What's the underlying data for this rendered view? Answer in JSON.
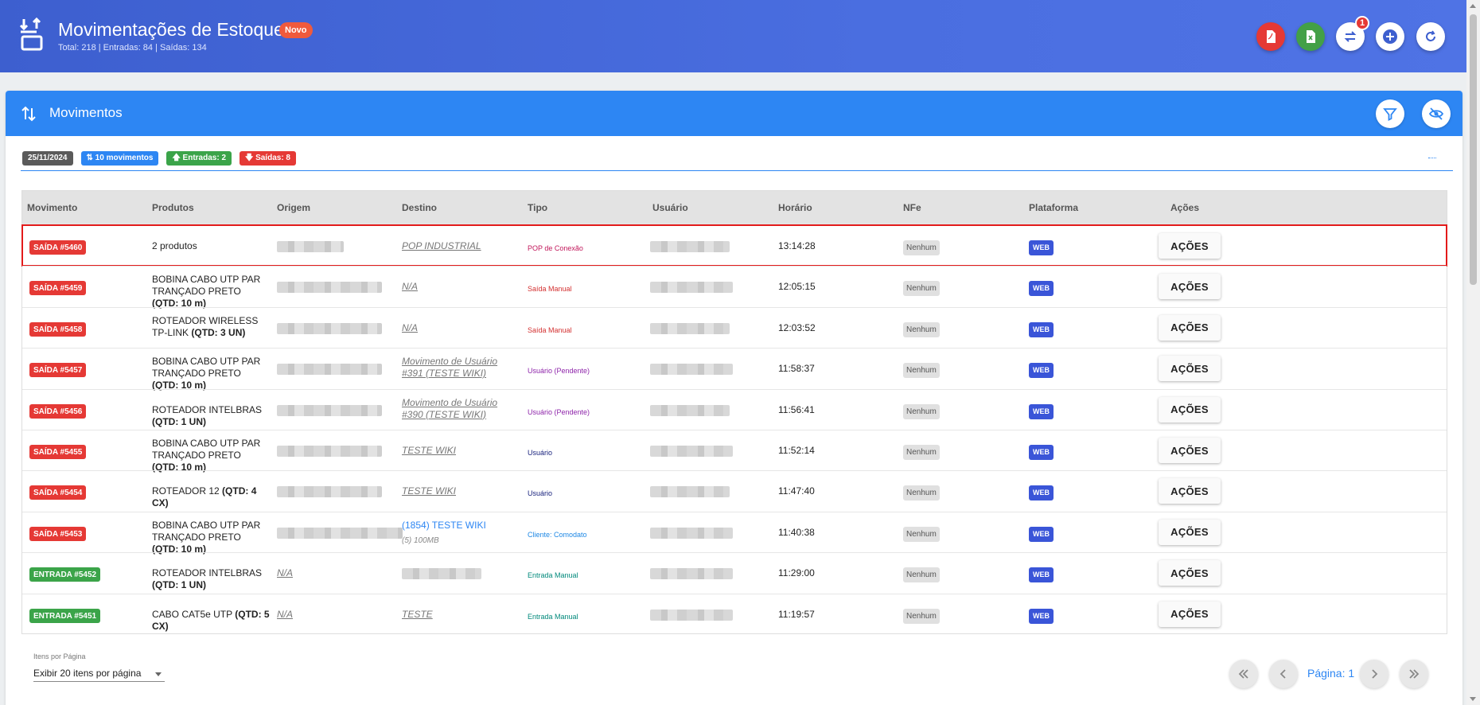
{
  "header": {
    "title": "Movimentações de Estoque",
    "new_badge": "Novo",
    "subtitle": "Total: 218 | Entradas: 84 | Saídas: 134",
    "notification_count": "1",
    "buttons": [
      "export-pdf",
      "export-excel",
      "transfers",
      "add",
      "refresh"
    ]
  },
  "panel": {
    "title": "Movimentos",
    "chips": {
      "date": "25/11/2024",
      "movements": "10 movimentos",
      "entries": "Entradas: 2",
      "exits": "Saídas: 8"
    }
  },
  "table": {
    "columns": [
      "Movimento",
      "Produtos",
      "Origem",
      "Destino",
      "Tipo",
      "Usuário",
      "Horário",
      "NFe",
      "Plataforma",
      "Ações"
    ],
    "rows": [
      {
        "movement": "SAÍDA #5460",
        "kind": "out",
        "product": "2 produtos",
        "product_qty": "",
        "origin": "",
        "dest": "POP INDUSTRIAL",
        "dest_sub": "",
        "type": "POP de Conexão",
        "type_color": "#c2185b",
        "time": "13:14:28",
        "nfe": "Nenhum",
        "platform": "WEB",
        "action": "AÇÕES"
      },
      {
        "movement": "SAÍDA #5459",
        "kind": "out",
        "product": "BOBINA CABO UTP PAR TRANÇADO PRETO",
        "product_qty": "(QTD: 10 m)",
        "origin": "",
        "dest": "N/A",
        "dest_sub": "",
        "type": "Saída Manual",
        "type_color": "#d32f2f",
        "time": "12:05:15",
        "nfe": "Nenhum",
        "platform": "WEB",
        "action": "AÇÕES"
      },
      {
        "movement": "SAÍDA #5458",
        "kind": "out",
        "product": "ROTEADOR WIRELESS TP-LINK",
        "product_qty": "(QTD: 3 UN)",
        "origin": "",
        "dest": "N/A",
        "dest_sub": "",
        "type": "Saída Manual",
        "type_color": "#d32f2f",
        "time": "12:03:52",
        "nfe": "Nenhum",
        "platform": "WEB",
        "action": "AÇÕES"
      },
      {
        "movement": "SAÍDA #5457",
        "kind": "out",
        "product": "BOBINA CABO UTP PAR TRANÇADO PRETO",
        "product_qty": "(QTD: 10 m)",
        "origin": "",
        "dest": "Movimento de Usuário #391 (TESTE WIKI)",
        "dest_sub": "",
        "type": "Usuário (Pendente)",
        "type_color": "#8e24aa",
        "time": "11:58:37",
        "nfe": "Nenhum",
        "platform": "WEB",
        "action": "AÇÕES"
      },
      {
        "movement": "SAÍDA #5456",
        "kind": "out",
        "product": "ROTEADOR INTELBRAS",
        "product_qty": "(QTD: 1 UN)",
        "origin": "",
        "dest": "Movimento de Usuário #390 (TESTE WIKI)",
        "dest_sub": "",
        "type": "Usuário (Pendente)",
        "type_color": "#8e24aa",
        "time": "11:56:41",
        "nfe": "Nenhum",
        "platform": "WEB",
        "action": "AÇÕES"
      },
      {
        "movement": "SAÍDA #5455",
        "kind": "out",
        "product": "BOBINA CABO UTP PAR TRANÇADO PRETO",
        "product_qty": "(QTD: 10 m)",
        "origin": "",
        "dest": "TESTE WIKI",
        "dest_sub": "",
        "type": "Usuário",
        "type_color": "#1a237e",
        "time": "11:52:14",
        "nfe": "Nenhum",
        "platform": "WEB",
        "action": "AÇÕES"
      },
      {
        "movement": "SAÍDA #5454",
        "kind": "out",
        "product": "ROTEADOR 12",
        "product_qty": "(QTD: 4 CX)",
        "origin": "",
        "dest": "TESTE WIKI",
        "dest_sub": "",
        "type": "Usuário",
        "type_color": "#1a237e",
        "time": "11:47:40",
        "nfe": "Nenhum",
        "platform": "WEB",
        "action": "AÇÕES"
      },
      {
        "movement": "SAÍDA #5453",
        "kind": "out",
        "product": "BOBINA CABO UTP PAR TRANÇADO PRETO",
        "product_qty": "(QTD: 10 m)",
        "origin": "",
        "dest": "(1854) TESTE WIKI",
        "dest_sub": "(5) 100MB",
        "type": "Cliente: Comodato",
        "type_color": "#1e88e5",
        "time": "11:40:38",
        "nfe": "Nenhum",
        "platform": "WEB",
        "action": "AÇÕES"
      },
      {
        "movement": "ENTRADA #5452",
        "kind": "in",
        "product": "ROTEADOR INTELBRAS",
        "product_qty": "(QTD: 1 UN)",
        "origin": "N/A",
        "dest": "",
        "dest_sub": "",
        "type": "Entrada Manual",
        "type_color": "#00897b",
        "time": "11:29:00",
        "nfe": "Nenhum",
        "platform": "WEB",
        "action": "AÇÕES"
      },
      {
        "movement": "ENTRADA #5451",
        "kind": "in",
        "product": "CABO CAT5e UTP",
        "product_qty": "(QTD: 5 CX)",
        "origin": "N/A",
        "dest": "TESTE",
        "dest_sub": "",
        "type": "Entrada Manual",
        "type_color": "#00897b",
        "time": "11:19:57",
        "nfe": "Nenhum",
        "platform": "WEB",
        "action": "AÇÕES"
      }
    ]
  },
  "footer": {
    "items_label": "Itens por Página",
    "items_value": "Exibir 20 itens por página",
    "page_label": "Página: 1"
  },
  "colors": {
    "header": "#4a6ee0",
    "panel_header": "#2d86f3",
    "exit": "#e53935",
    "entry": "#3ba449",
    "web": "#3a55d8"
  }
}
